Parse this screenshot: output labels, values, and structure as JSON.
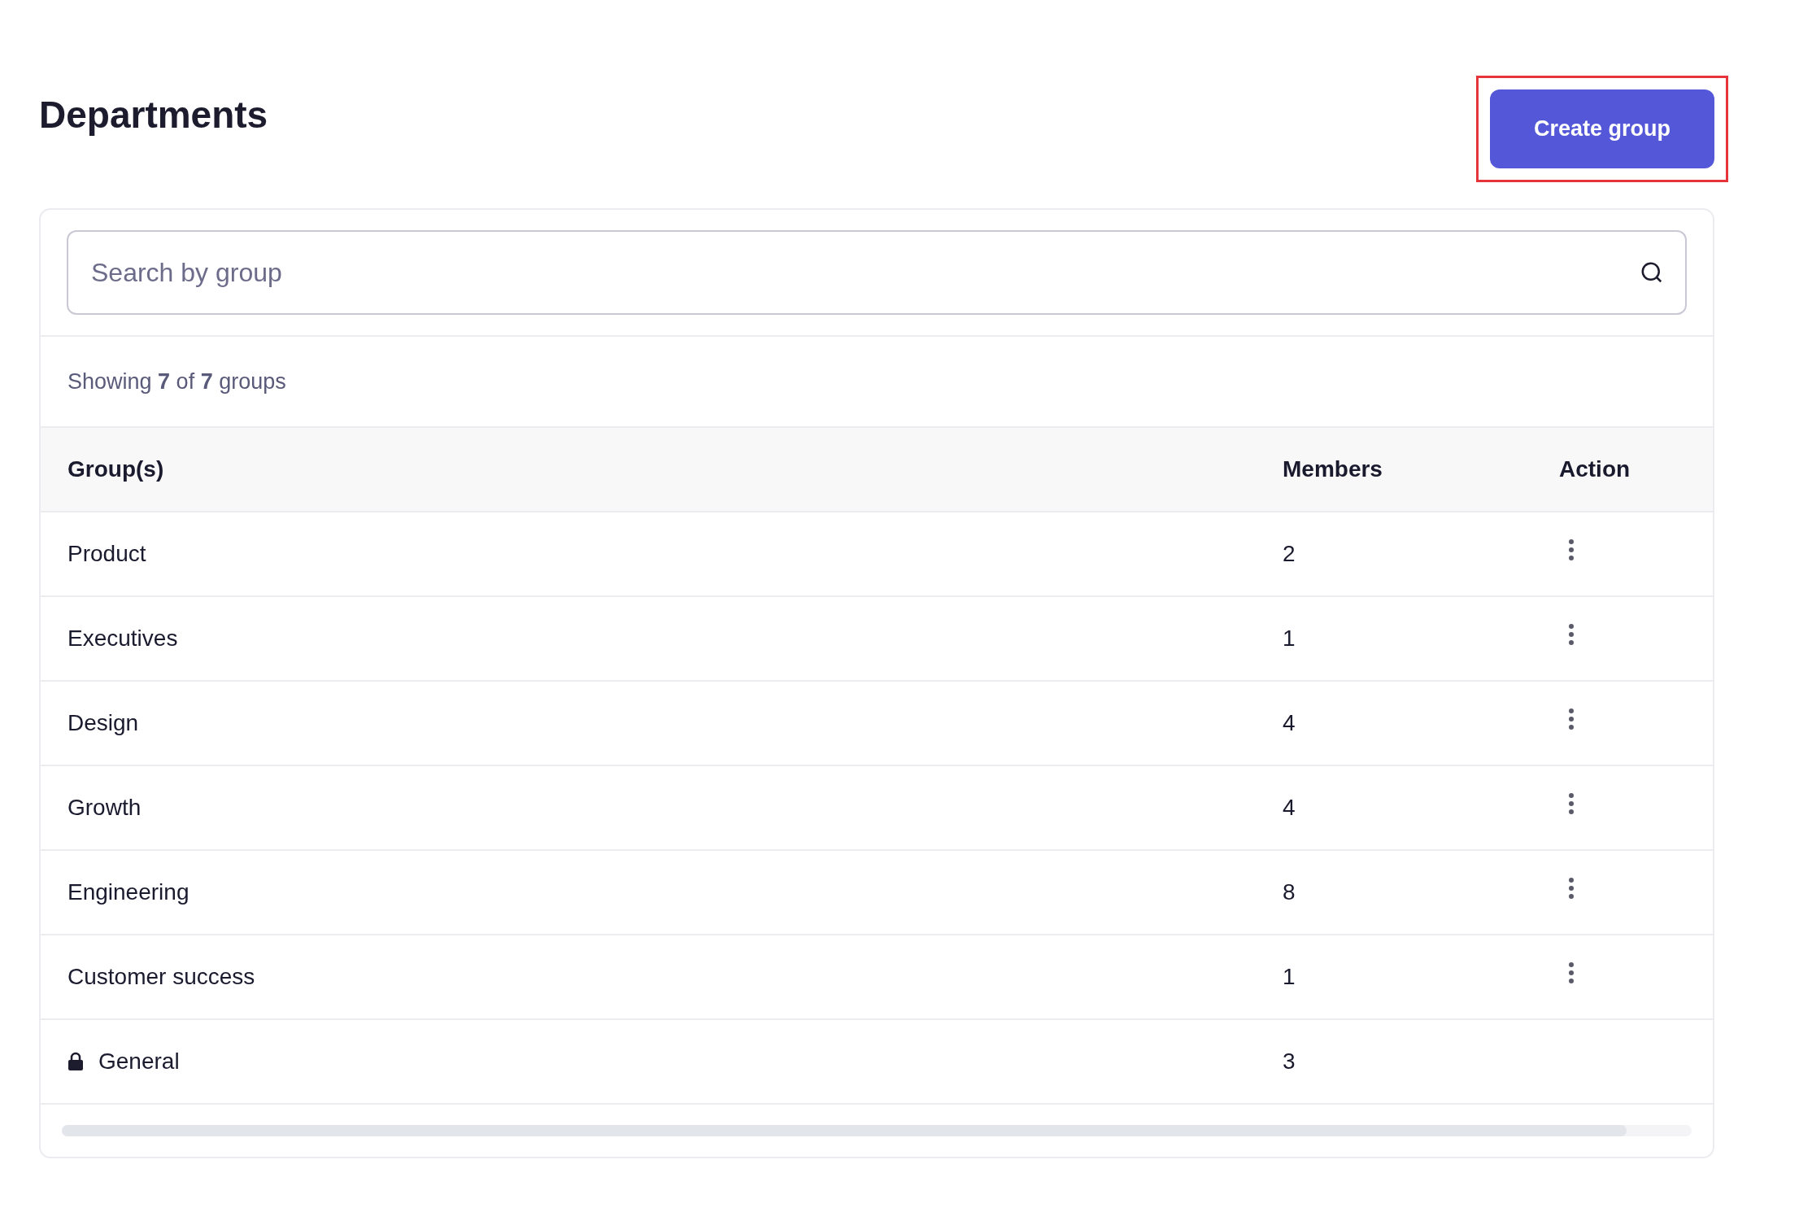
{
  "page": {
    "title": "Departments",
    "create_button": "Create group"
  },
  "search": {
    "placeholder": "Search by group"
  },
  "summary": "Showing **7** of **7** groups",
  "table": {
    "columns": [
      "Group(s)",
      "Members",
      "Action"
    ],
    "rows": [
      {
        "group": "Product",
        "members": "2",
        "locked": false
      },
      {
        "group": "Executives",
        "members": "1",
        "locked": false
      },
      {
        "group": "Design",
        "members": "4",
        "locked": false
      },
      {
        "group": "Growth",
        "members": "4",
        "locked": false
      },
      {
        "group": "Engineering",
        "members": "8",
        "locked": false
      },
      {
        "group": "Customer success",
        "members": "1",
        "locked": false
      },
      {
        "group": "General",
        "members": "3",
        "locked": true
      }
    ]
  }
}
